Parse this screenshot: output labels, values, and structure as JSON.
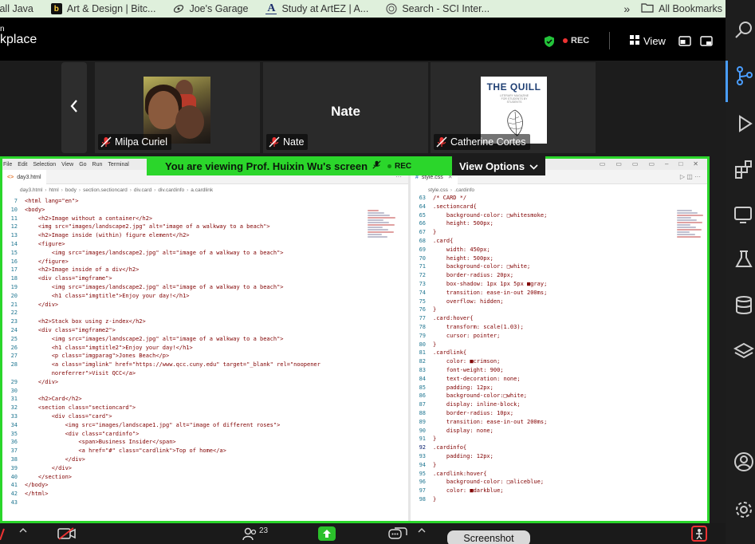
{
  "bookmarks": {
    "items": [
      {
        "label": "tall Java",
        "icon": "java-icon"
      },
      {
        "label": "Art & Design | Bitc...",
        "icon": "bitcoin-icon",
        "badge": "b"
      },
      {
        "label": "Joe's Garage",
        "icon": "garage-icon"
      },
      {
        "label": "Study at ArtEZ | A...",
        "icon": "artez-icon",
        "badge": "A"
      },
      {
        "label": "Search - SCI Inter...",
        "icon": "sci-icon"
      }
    ],
    "more": "»",
    "all_label": "All Bookmarks"
  },
  "meeting": {
    "title_line1": "n",
    "title_line2": "kplace",
    "rec_label": "REC",
    "view_label": "View"
  },
  "participants": [
    {
      "name": "Milpa Curiel",
      "muted": true,
      "display": "photo"
    },
    {
      "name": "Nate",
      "muted": true,
      "display": "name",
      "big_name": "Nate"
    },
    {
      "name": "Catherine Cortes",
      "muted": true,
      "display": "logo",
      "logo_title": "THE QUILL",
      "logo_sub": "LITERARY MAGAZINE FOR STUDENTS BY STUDENTS"
    }
  ],
  "share": {
    "banner_text": "You are viewing  Prof. Huixin Wu's screen",
    "rec_label": "REC",
    "view_options": "View Options"
  },
  "vscode": {
    "menu": [
      "File",
      "Edit",
      "Selection",
      "View",
      "Go",
      "Run",
      "Terminal"
    ],
    "left": {
      "tab": "day3.html",
      "breadcrumbs": [
        "day3.html",
        "html",
        "body",
        "section.sectioncard",
        "div.card",
        "div.cardinfo",
        "a.cardlink"
      ],
      "lines": [
        {
          "n": "7",
          "t": "<html lang=\"en\">"
        },
        {
          "n": "10",
          "t": "<body>"
        },
        {
          "n": "11",
          "t": "    <h2>Image without a container</h2>"
        },
        {
          "n": "12",
          "t": "    <img src=\"images/landscape2.jpg\" alt=\"image of a walkway to a beach\">"
        },
        {
          "n": "13",
          "t": "    <h2>Image inside (within) figure element</h2>"
        },
        {
          "n": "14",
          "t": "    <figure>"
        },
        {
          "n": "15",
          "t": "        <img src=\"images/landscape2.jpg\" alt=\"image of a walkway to a beach\">"
        },
        {
          "n": "16",
          "t": "    </figure>"
        },
        {
          "n": "17",
          "t": "    <h2>Image inside of a div</h2>"
        },
        {
          "n": "18",
          "t": "    <div class=\"imgframe\">"
        },
        {
          "n": "19",
          "t": "        <img src=\"images/landscape2.jpg\" alt=\"image of a walkway to a beach\">"
        },
        {
          "n": "20",
          "t": "        <h1 class=\"imgtitle\">Enjoy your day!</h1>"
        },
        {
          "n": "21",
          "t": "    </div>"
        },
        {
          "n": "22",
          "t": ""
        },
        {
          "n": "23",
          "t": "    <h2>Stack box using z-index</h2>"
        },
        {
          "n": "24",
          "t": "    <div class=\"imgframe2\">"
        },
        {
          "n": "25",
          "t": "        <img src=\"images/landscape2.jpg\" alt=\"image of a walkway to a beach\">"
        },
        {
          "n": "26",
          "t": "        <h1 class=\"imgtitle2\">Enjoy your day!</h1>"
        },
        {
          "n": "27",
          "t": "        <p class=\"imgparag\">Jones Beach</p>"
        },
        {
          "n": "28",
          "t": "        <a class=\"imglink\" href=\"https://www.qcc.cuny.edu\" target=\"_blank\" rel=\"noopener"
        },
        {
          "n": "",
          "t": "        noreferrer\">Visit QCC</a>"
        },
        {
          "n": "29",
          "t": "    </div>"
        },
        {
          "n": "30",
          "t": ""
        },
        {
          "n": "31",
          "t": "    <h2>Card</h2>"
        },
        {
          "n": "32",
          "t": "    <section class=\"sectioncard\">"
        },
        {
          "n": "33",
          "t": "        <div class=\"card\">"
        },
        {
          "n": "34",
          "t": "            <img src=\"images/landscape1.jpg\" alt=\"image of different roses\">"
        },
        {
          "n": "35",
          "t": "            <div class=\"cardinfo\">"
        },
        {
          "n": "36",
          "t": "                <span>Business Insider</span>"
        },
        {
          "n": "37",
          "t": "                <a href=\"#\" class=\"cardlink\">Top of home</a>"
        },
        {
          "n": "38",
          "t": "            </div>"
        },
        {
          "n": "39",
          "t": "        </div>"
        },
        {
          "n": "40",
          "t": "    </section>"
        },
        {
          "n": "41",
          "t": "</body>"
        },
        {
          "n": "42",
          "t": "</html>"
        },
        {
          "n": "43",
          "t": ""
        }
      ]
    },
    "right": {
      "tab": "style.css",
      "breadcrumbs": [
        "style.css",
        ".cardinfo"
      ],
      "lines": [
        {
          "n": "63",
          "t": "/* CARD */"
        },
        {
          "n": "64",
          "t": ".sectioncard{"
        },
        {
          "n": "65",
          "t": "    background-color: □whitesmoke;"
        },
        {
          "n": "66",
          "t": "    height: 500px;"
        },
        {
          "n": "67",
          "t": "}"
        },
        {
          "n": "68",
          "t": ".card{"
        },
        {
          "n": "69",
          "t": "    width: 450px;"
        },
        {
          "n": "70",
          "t": "    height: 500px;"
        },
        {
          "n": "71",
          "t": "    background-color: □white;"
        },
        {
          "n": "72",
          "t": "    border-radius: 20px;"
        },
        {
          "n": "73",
          "t": "    box-shadow: 1px 1px 5px ■gray;"
        },
        {
          "n": "74",
          "t": "    transition: ease-in-out 200ms;"
        },
        {
          "n": "75",
          "t": "    overflow: hidden;"
        },
        {
          "n": "76",
          "t": "}"
        },
        {
          "n": "77",
          "t": ".card:hover{"
        },
        {
          "n": "78",
          "t": "    transform: scale(1.03);"
        },
        {
          "n": "79",
          "t": "    cursor: pointer;"
        },
        {
          "n": "80",
          "t": "}"
        },
        {
          "n": "81",
          "t": ".cardlink{"
        },
        {
          "n": "82",
          "t": "    color: ■crimson;"
        },
        {
          "n": "83",
          "t": "    font-weight: 900;"
        },
        {
          "n": "84",
          "t": "    text-decoration: none;"
        },
        {
          "n": "85",
          "t": "    padding: 12px;"
        },
        {
          "n": "86",
          "t": "    background-color:□white;"
        },
        {
          "n": "87",
          "t": "    display: inline-block;"
        },
        {
          "n": "88",
          "t": "    border-radius: 10px;"
        },
        {
          "n": "89",
          "t": "    transition: ease-in-out 200ms;"
        },
        {
          "n": "90",
          "t": "    display: none;"
        },
        {
          "n": "91",
          "t": "}"
        },
        {
          "n": "92",
          "t": ".cardinfo{"
        },
        {
          "n": "93",
          "t": "    padding: 12px;"
        },
        {
          "n": "94",
          "t": "}"
        },
        {
          "n": "95",
          "t": ".cardlink:hover{"
        },
        {
          "n": "96",
          "t": "    background-color: □aliceblue;"
        },
        {
          "n": "97",
          "t": "    color: ■darkblue;"
        },
        {
          "n": "98",
          "t": "}"
        }
      ]
    }
  },
  "bottom": {
    "participant_count": "23",
    "screenshot_label": "Screenshot"
  },
  "colors": {
    "share_green": "#2bd62b",
    "rec_red": "#ee3333",
    "vscode_tag": "#800000",
    "line_number": "#237893"
  }
}
